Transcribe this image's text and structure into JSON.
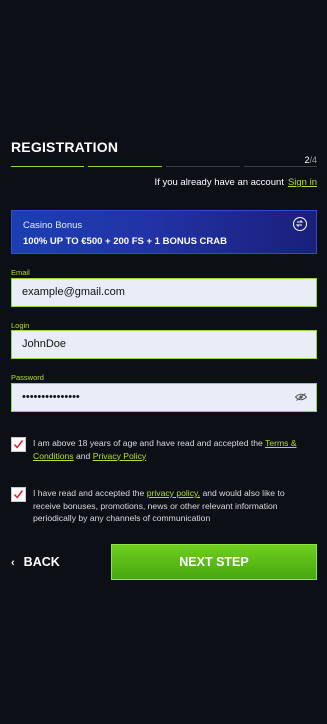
{
  "header": {
    "title": "REGISTRATION"
  },
  "steps": {
    "current": "2",
    "separator": "/",
    "total": "4"
  },
  "signin": {
    "prompt": "If you already have an account",
    "link": "Sign in"
  },
  "bonus": {
    "label": "Casino Bonus",
    "text": "100% UP TO €500 + 200 FS + 1 BONUS CRAB"
  },
  "form": {
    "email": {
      "label": "Email",
      "value": "example@gmail.com"
    },
    "login": {
      "label": "Login",
      "value": "JohnDoe"
    },
    "password": {
      "label": "Password",
      "value": "•••••••••••••••"
    }
  },
  "consent": {
    "terms": {
      "before": "I am above 18 years of age and have read and accepted the ",
      "terms_link": "Terms & Conditions",
      "middle": " and ",
      "privacy_link": "Privacy Policy"
    },
    "marketing": {
      "before": "I have read and accepted the ",
      "privacy_link": "privacy policy,",
      "after": " and would also like to receive bonuses, promotions, news or other relevant information periodically by any channels of communication"
    }
  },
  "nav": {
    "back_label": "BACK",
    "next_label": "NEXT STEP"
  },
  "colors": {
    "accent": "#b3e02a",
    "button": "#5bbb17",
    "bonus": "#1f3aa8",
    "background": "#0d0f16"
  }
}
